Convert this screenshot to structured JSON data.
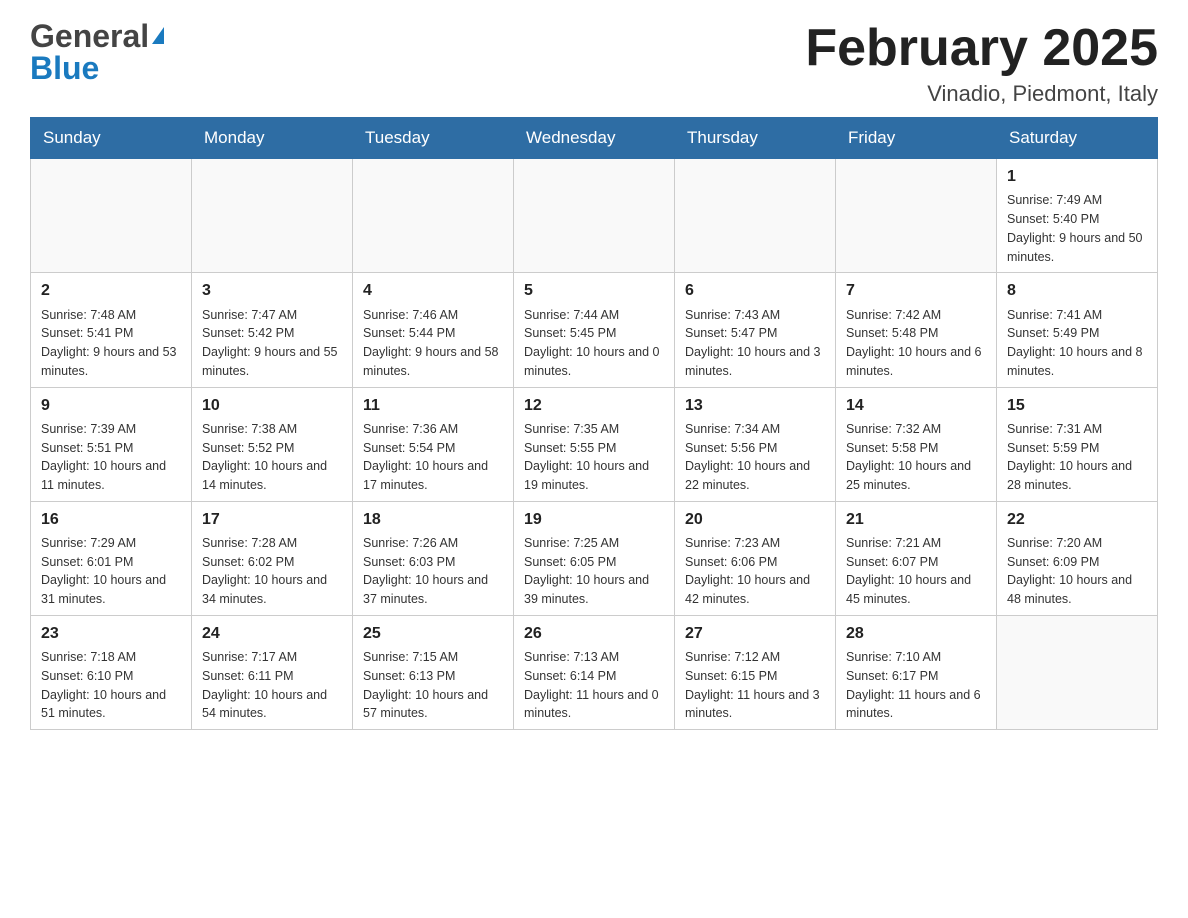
{
  "header": {
    "logo_general": "General",
    "logo_blue": "Blue",
    "month_title": "February 2025",
    "location": "Vinadio, Piedmont, Italy"
  },
  "weekdays": [
    "Sunday",
    "Monday",
    "Tuesday",
    "Wednesday",
    "Thursday",
    "Friday",
    "Saturday"
  ],
  "weeks": [
    [
      {
        "day": "",
        "sunrise": "",
        "sunset": "",
        "daylight": ""
      },
      {
        "day": "",
        "sunrise": "",
        "sunset": "",
        "daylight": ""
      },
      {
        "day": "",
        "sunrise": "",
        "sunset": "",
        "daylight": ""
      },
      {
        "day": "",
        "sunrise": "",
        "sunset": "",
        "daylight": ""
      },
      {
        "day": "",
        "sunrise": "",
        "sunset": "",
        "daylight": ""
      },
      {
        "day": "",
        "sunrise": "",
        "sunset": "",
        "daylight": ""
      },
      {
        "day": "1",
        "sunrise": "Sunrise: 7:49 AM",
        "sunset": "Sunset: 5:40 PM",
        "daylight": "Daylight: 9 hours and 50 minutes."
      }
    ],
    [
      {
        "day": "2",
        "sunrise": "Sunrise: 7:48 AM",
        "sunset": "Sunset: 5:41 PM",
        "daylight": "Daylight: 9 hours and 53 minutes."
      },
      {
        "day": "3",
        "sunrise": "Sunrise: 7:47 AM",
        "sunset": "Sunset: 5:42 PM",
        "daylight": "Daylight: 9 hours and 55 minutes."
      },
      {
        "day": "4",
        "sunrise": "Sunrise: 7:46 AM",
        "sunset": "Sunset: 5:44 PM",
        "daylight": "Daylight: 9 hours and 58 minutes."
      },
      {
        "day": "5",
        "sunrise": "Sunrise: 7:44 AM",
        "sunset": "Sunset: 5:45 PM",
        "daylight": "Daylight: 10 hours and 0 minutes."
      },
      {
        "day": "6",
        "sunrise": "Sunrise: 7:43 AM",
        "sunset": "Sunset: 5:47 PM",
        "daylight": "Daylight: 10 hours and 3 minutes."
      },
      {
        "day": "7",
        "sunrise": "Sunrise: 7:42 AM",
        "sunset": "Sunset: 5:48 PM",
        "daylight": "Daylight: 10 hours and 6 minutes."
      },
      {
        "day": "8",
        "sunrise": "Sunrise: 7:41 AM",
        "sunset": "Sunset: 5:49 PM",
        "daylight": "Daylight: 10 hours and 8 minutes."
      }
    ],
    [
      {
        "day": "9",
        "sunrise": "Sunrise: 7:39 AM",
        "sunset": "Sunset: 5:51 PM",
        "daylight": "Daylight: 10 hours and 11 minutes."
      },
      {
        "day": "10",
        "sunrise": "Sunrise: 7:38 AM",
        "sunset": "Sunset: 5:52 PM",
        "daylight": "Daylight: 10 hours and 14 minutes."
      },
      {
        "day": "11",
        "sunrise": "Sunrise: 7:36 AM",
        "sunset": "Sunset: 5:54 PM",
        "daylight": "Daylight: 10 hours and 17 minutes."
      },
      {
        "day": "12",
        "sunrise": "Sunrise: 7:35 AM",
        "sunset": "Sunset: 5:55 PM",
        "daylight": "Daylight: 10 hours and 19 minutes."
      },
      {
        "day": "13",
        "sunrise": "Sunrise: 7:34 AM",
        "sunset": "Sunset: 5:56 PM",
        "daylight": "Daylight: 10 hours and 22 minutes."
      },
      {
        "day": "14",
        "sunrise": "Sunrise: 7:32 AM",
        "sunset": "Sunset: 5:58 PM",
        "daylight": "Daylight: 10 hours and 25 minutes."
      },
      {
        "day": "15",
        "sunrise": "Sunrise: 7:31 AM",
        "sunset": "Sunset: 5:59 PM",
        "daylight": "Daylight: 10 hours and 28 minutes."
      }
    ],
    [
      {
        "day": "16",
        "sunrise": "Sunrise: 7:29 AM",
        "sunset": "Sunset: 6:01 PM",
        "daylight": "Daylight: 10 hours and 31 minutes."
      },
      {
        "day": "17",
        "sunrise": "Sunrise: 7:28 AM",
        "sunset": "Sunset: 6:02 PM",
        "daylight": "Daylight: 10 hours and 34 minutes."
      },
      {
        "day": "18",
        "sunrise": "Sunrise: 7:26 AM",
        "sunset": "Sunset: 6:03 PM",
        "daylight": "Daylight: 10 hours and 37 minutes."
      },
      {
        "day": "19",
        "sunrise": "Sunrise: 7:25 AM",
        "sunset": "Sunset: 6:05 PM",
        "daylight": "Daylight: 10 hours and 39 minutes."
      },
      {
        "day": "20",
        "sunrise": "Sunrise: 7:23 AM",
        "sunset": "Sunset: 6:06 PM",
        "daylight": "Daylight: 10 hours and 42 minutes."
      },
      {
        "day": "21",
        "sunrise": "Sunrise: 7:21 AM",
        "sunset": "Sunset: 6:07 PM",
        "daylight": "Daylight: 10 hours and 45 minutes."
      },
      {
        "day": "22",
        "sunrise": "Sunrise: 7:20 AM",
        "sunset": "Sunset: 6:09 PM",
        "daylight": "Daylight: 10 hours and 48 minutes."
      }
    ],
    [
      {
        "day": "23",
        "sunrise": "Sunrise: 7:18 AM",
        "sunset": "Sunset: 6:10 PM",
        "daylight": "Daylight: 10 hours and 51 minutes."
      },
      {
        "day": "24",
        "sunrise": "Sunrise: 7:17 AM",
        "sunset": "Sunset: 6:11 PM",
        "daylight": "Daylight: 10 hours and 54 minutes."
      },
      {
        "day": "25",
        "sunrise": "Sunrise: 7:15 AM",
        "sunset": "Sunset: 6:13 PM",
        "daylight": "Daylight: 10 hours and 57 minutes."
      },
      {
        "day": "26",
        "sunrise": "Sunrise: 7:13 AM",
        "sunset": "Sunset: 6:14 PM",
        "daylight": "Daylight: 11 hours and 0 minutes."
      },
      {
        "day": "27",
        "sunrise": "Sunrise: 7:12 AM",
        "sunset": "Sunset: 6:15 PM",
        "daylight": "Daylight: 11 hours and 3 minutes."
      },
      {
        "day": "28",
        "sunrise": "Sunrise: 7:10 AM",
        "sunset": "Sunset: 6:17 PM",
        "daylight": "Daylight: 11 hours and 6 minutes."
      },
      {
        "day": "",
        "sunrise": "",
        "sunset": "",
        "daylight": ""
      }
    ]
  ]
}
